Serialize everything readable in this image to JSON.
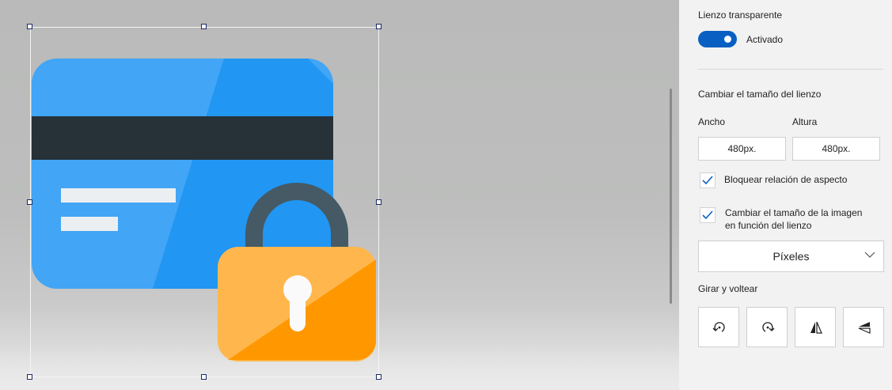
{
  "canvas": {
    "card_color": "#42a5f5",
    "stripe_color": "#263238",
    "lock_body_color": "#ffb74d",
    "lock_shackle_color": "#455a64",
    "selection_handle_color": "#1a2a66",
    "icon": "credit-card-lock-icon"
  },
  "panel": {
    "transparent_canvas": {
      "label": "Lienzo transparente",
      "state": "Activado",
      "on": true
    },
    "resize": {
      "section_label": "Cambiar el tamaño del lienzo",
      "width_label": "Ancho",
      "height_label": "Altura",
      "width_value": "480px.",
      "height_value": "480px."
    },
    "lock_aspect": {
      "label": "Bloquear relación de aspecto",
      "checked": true
    },
    "resize_image": {
      "line1": "Cambiar el tamaño de la imagen",
      "line2": "en función del lienzo",
      "checked": true
    },
    "units": {
      "selected": "Píxeles"
    },
    "rotate_flip": {
      "section_label": "Girar y voltear",
      "buttons": [
        "rotate-left-icon",
        "rotate-right-icon",
        "flip-horizontal-icon",
        "flip-vertical-icon"
      ]
    },
    "accent_color": "#0a5fc2"
  }
}
